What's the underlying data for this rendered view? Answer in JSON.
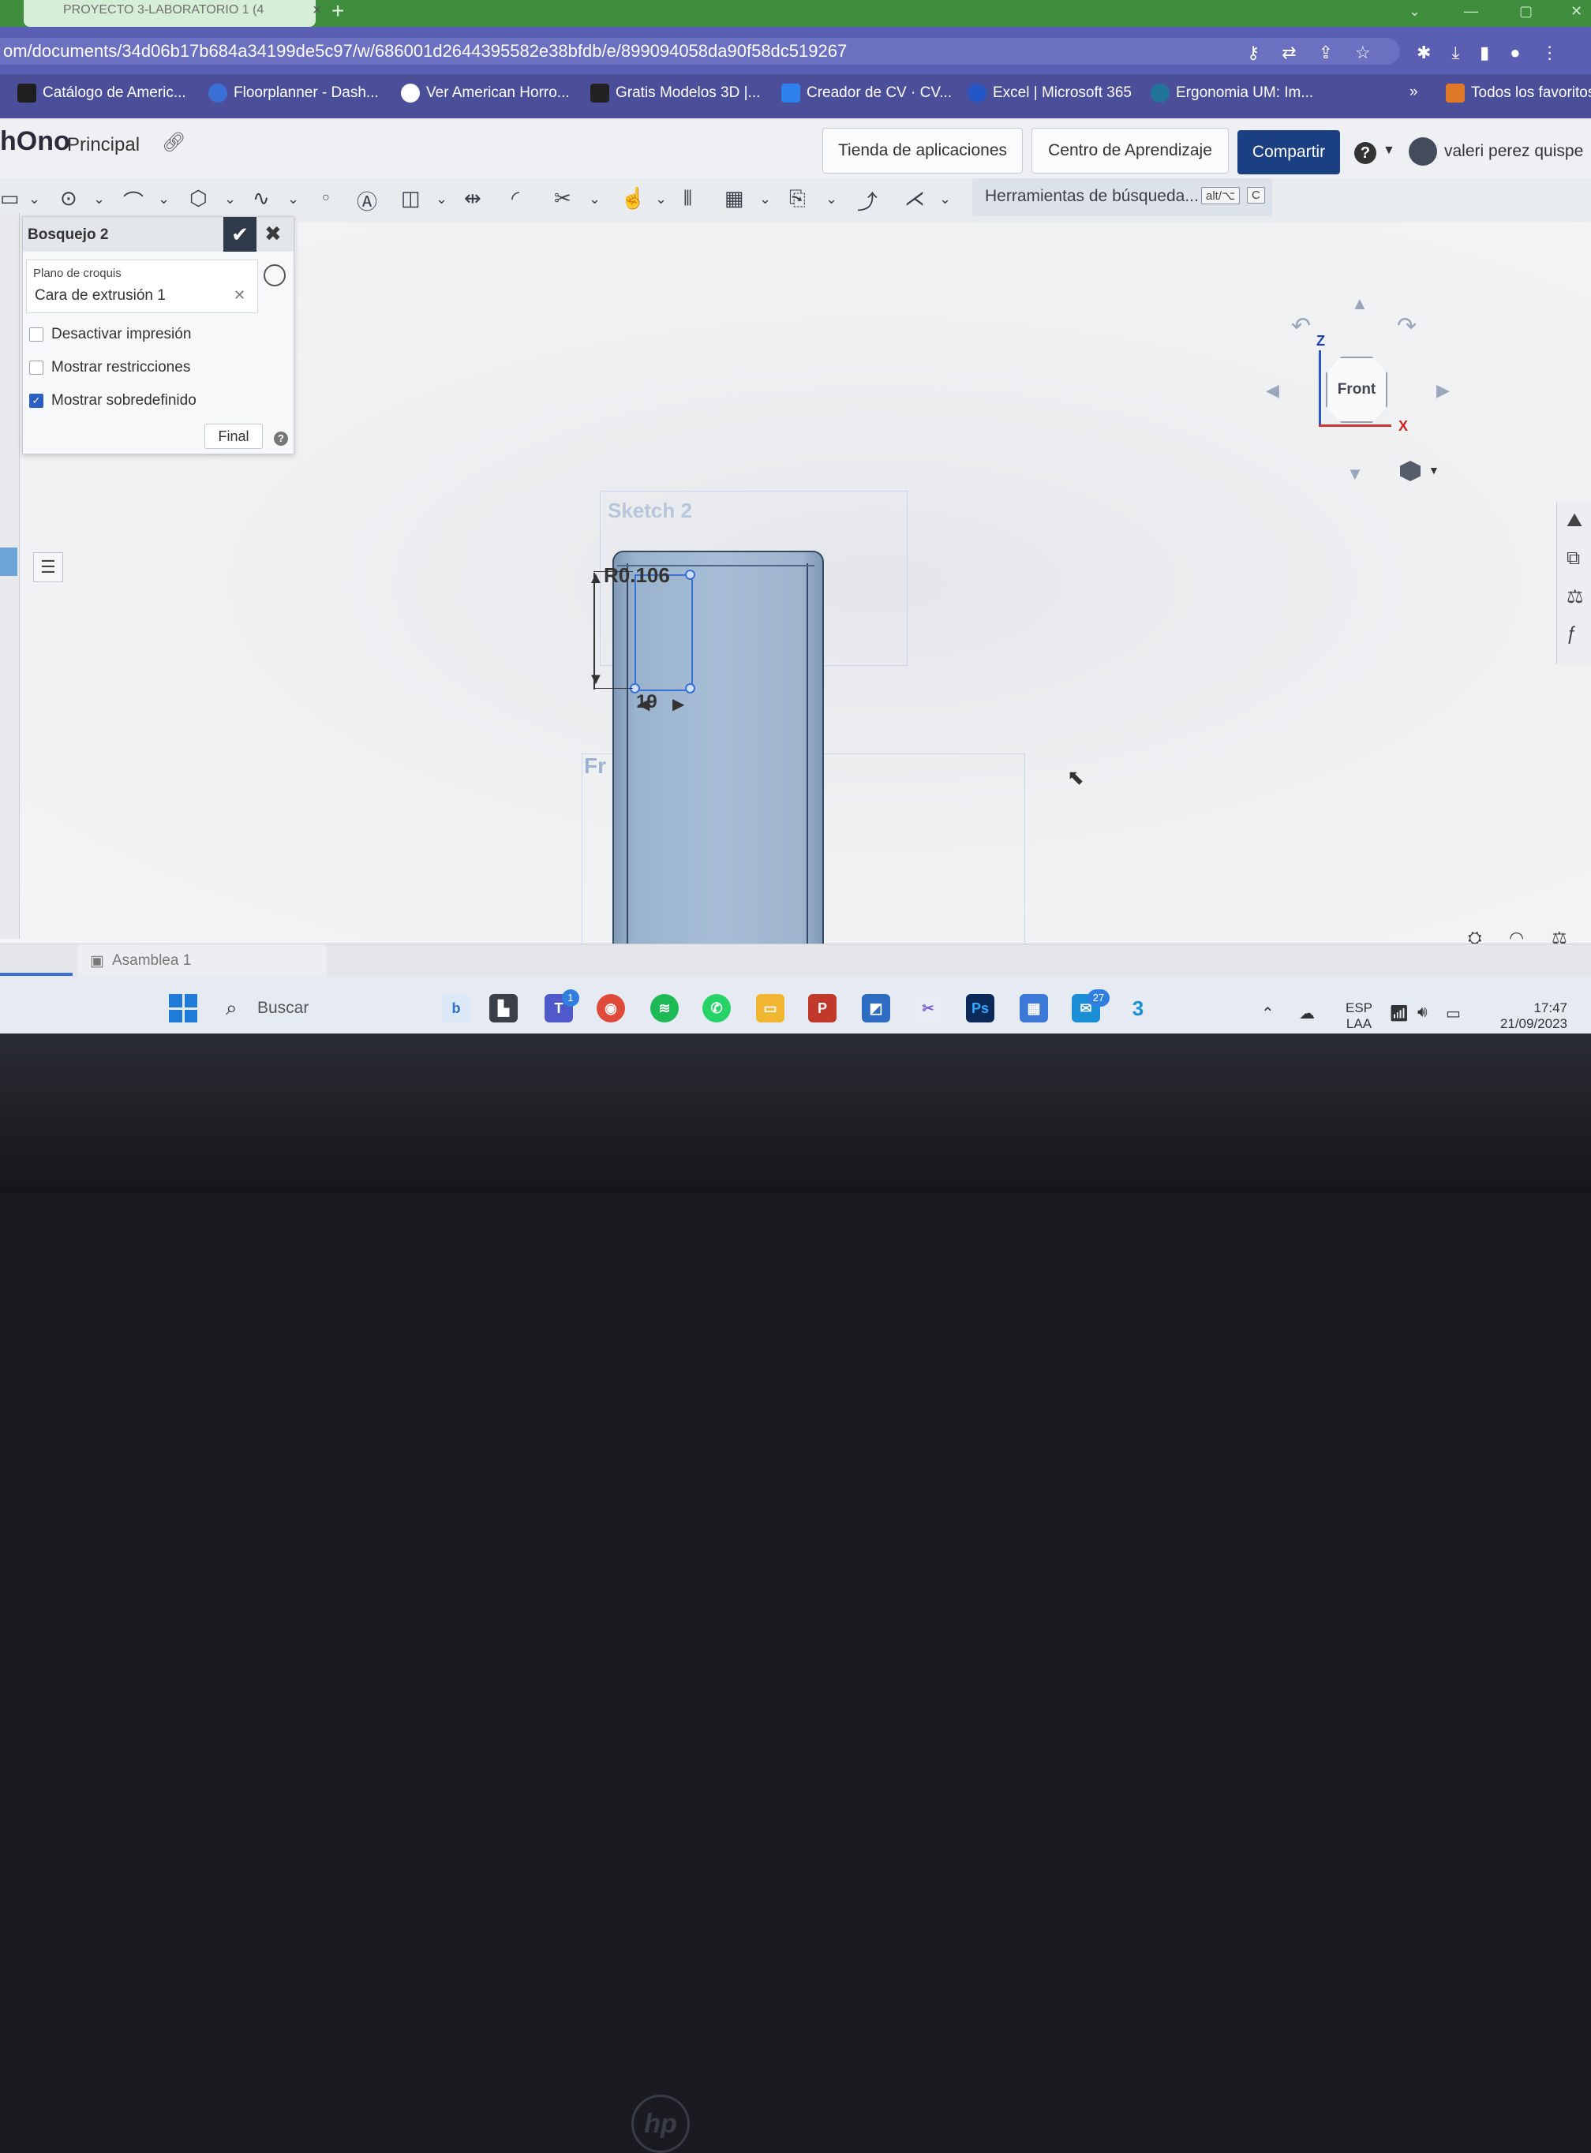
{
  "browser": {
    "tab_title": "PROYECTO 3-LABORATORIO 1 (4",
    "url": "om/documents/34d06b17b684a34199de5c97/w/686001d2644395582e38bfdb/e/899094058da90f58dc519267",
    "bookmarks": [
      {
        "label": "Catálogo de Americ...",
        "color": "#1e1e1e"
      },
      {
        "label": "Floorplanner - Dash...",
        "color": "#3b6fd6"
      },
      {
        "label": "Ver American Horro...",
        "color": "#ffffff"
      },
      {
        "label": "Gratis Modelos 3D |...",
        "color": "#222222"
      },
      {
        "label": "Creador de CV · CV...",
        "color": "#2f80ed"
      },
      {
        "label": "Excel | Microsoft 365",
        "color": "#2457c5"
      },
      {
        "label": "Ergonomia UM: Im...",
        "color": "#21759b"
      }
    ],
    "more_bookmarks": "»",
    "all_bookmarks": "Todos los favoritos"
  },
  "app": {
    "logo": "hOno",
    "document_name": "Principal",
    "app_store_button": "Tienda de aplicaciones",
    "learning_center_button": "Centro de Aprendizaje",
    "share_button": "Compartir",
    "help": "?",
    "user_name": "valeri perez quispe"
  },
  "toolbar": {
    "search_tools": "Herramientas de búsqueda...",
    "shortcut_1": "alt/⌥",
    "shortcut_2": "C"
  },
  "sketch_dialog": {
    "title": "Bosquejo 2",
    "plane_label": "Plano de croquis",
    "plane_value": "Cara de extrusión 1",
    "options": [
      {
        "label": "Desactivar impresión",
        "checked": false
      },
      {
        "label": "Mostrar restricciones",
        "checked": false
      },
      {
        "label": "Mostrar sobredefinido",
        "checked": true
      }
    ],
    "final_button": "Final"
  },
  "viewport": {
    "sketch_label": "Sketch 2",
    "front_plane_label": "Fr",
    "dimension_vertical": "R0.106",
    "dimension_horizontal": "19",
    "view_cube": {
      "face": "Front",
      "axis_z": "Z",
      "axis_x": "X"
    }
  },
  "bottom_tabs": {
    "assembly_tab": "Asamblea 1"
  },
  "taskbar": {
    "search_placeholder": "Buscar",
    "teams_badge": "1",
    "mail_badge": "27",
    "language": "ESP",
    "language_sub": "LAA",
    "time": "17:47",
    "date": "21/09/2023"
  }
}
